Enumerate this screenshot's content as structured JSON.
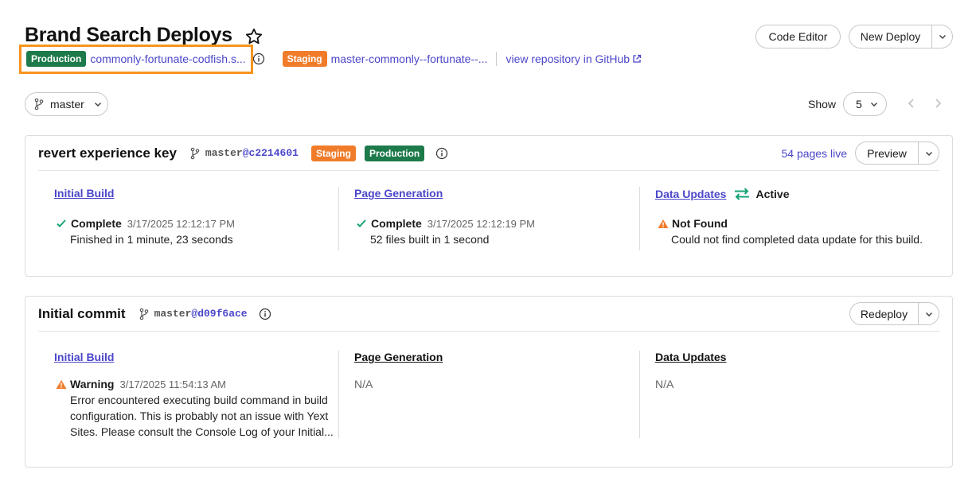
{
  "header": {
    "title": "Brand Search Deploys",
    "code_editor_label": "Code Editor",
    "new_deploy_label": "New Deploy"
  },
  "environments": {
    "production_badge": "Production",
    "production_url": "commonly-fortunate-codfish.s...",
    "staging_badge": "Staging",
    "staging_url": "master-commonly--fortunate--...",
    "repo_link": "view repository in GitHub"
  },
  "toolbar": {
    "branch": "master",
    "show_label": "Show",
    "show_value": "5"
  },
  "deploys": [
    {
      "title": "revert experience key",
      "branch": "master",
      "hash": "@c2214601",
      "badges": [
        "Staging",
        "Production"
      ],
      "pages_live": "54 pages live",
      "action_label": "Preview",
      "initial_build": {
        "title": "Initial Build",
        "status": "Complete",
        "timestamp": "3/17/2025 12:12:17 PM",
        "detail": "Finished in 1 minute, 23 seconds"
      },
      "page_generation": {
        "title": "Page Generation",
        "status": "Complete",
        "timestamp": "3/17/2025 12:12:19 PM",
        "detail": "52 files built in 1 second"
      },
      "data_updates": {
        "title": "Data Updates",
        "active_label": "Active",
        "status": "Not Found",
        "detail": "Could not find completed data update for this build."
      }
    },
    {
      "title": "Initial commit",
      "branch": "master",
      "hash": "@d09f6ace",
      "action_label": "Redeploy",
      "initial_build": {
        "title": "Initial Build",
        "status": "Warning",
        "timestamp": "3/17/2025 11:54:13 AM",
        "detail_lines": [
          "Error encountered executing build command in build",
          "configuration. This is probably not an issue with Yext",
          "Sites. Please consult the Console Log of your Initial..."
        ]
      },
      "page_generation": {
        "title": "Page Generation",
        "value": "N/A"
      },
      "data_updates": {
        "title": "Data Updates",
        "value": "N/A"
      }
    }
  ],
  "colors": {
    "accent_link": "#4b47c9",
    "production": "#1d7a4a",
    "staging": "#f07c2a",
    "success": "#1aa37a",
    "warning": "#f07c2a",
    "highlight": "#f7941d"
  },
  "icons": [
    "star-icon",
    "info-icon",
    "external-link-icon",
    "git-branch-icon",
    "chevron-down-icon",
    "chevron-left-icon",
    "chevron-right-icon",
    "check-icon",
    "warning-icon",
    "sync-arrows-icon"
  ]
}
